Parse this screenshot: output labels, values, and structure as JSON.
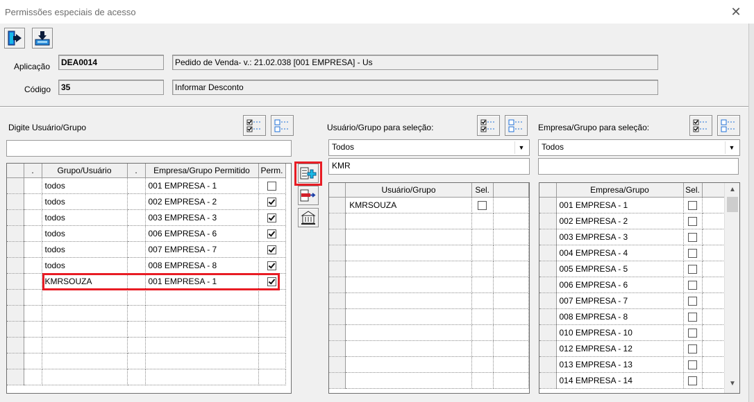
{
  "window": {
    "title": "Permissões especiais de acesso",
    "close_glyph": "✕"
  },
  "header": {
    "aplicacao_label": "Aplicação",
    "aplicacao_code": "DEA0014",
    "aplicacao_desc": "Pedido de Venda- v.: 21.02.038  [001 EMPRESA] - Us",
    "codigo_label": "Código",
    "codigo_code": "35",
    "codigo_desc": "Informar Desconto"
  },
  "left": {
    "label": "Digite Usuário/Grupo",
    "search_value": "",
    "columns": [
      ".",
      "Grupo/Usuário",
      ".",
      "Empresa/Grupo Permitido",
      "Perm."
    ],
    "rows": [
      {
        "user": "todos",
        "company": "001 EMPRESA - 1",
        "perm": false
      },
      {
        "user": "todos",
        "company": "002 EMPRESA - 2",
        "perm": true
      },
      {
        "user": "todos",
        "company": "003 EMPRESA - 3",
        "perm": true
      },
      {
        "user": "todos",
        "company": "006 EMPRESA - 6",
        "perm": true
      },
      {
        "user": "todos",
        "company": "007 EMPRESA - 7",
        "perm": true
      },
      {
        "user": "todos",
        "company": "008 EMPRESA - 8",
        "perm": true
      },
      {
        "user": "KMRSOUZA",
        "company": "001 EMPRESA - 1",
        "perm": true
      }
    ],
    "empty_rows": 6
  },
  "middle": {
    "label": "Usuário/Grupo para seleção:",
    "combo_value": "Todos",
    "filter_value": "KMR",
    "columns": [
      "Usuário/Grupo",
      "Sel."
    ],
    "rows": [
      {
        "user": "KMRSOUZA",
        "sel": false
      }
    ],
    "empty_rows": 11
  },
  "right": {
    "label": "Empresa/Grupo para seleção:",
    "combo_value": "Todos",
    "filter_value": "",
    "columns": [
      "Empresa/Grupo",
      "Sel."
    ],
    "rows": [
      {
        "company": "001 EMPRESA - 1",
        "sel": false
      },
      {
        "company": "002 EMPRESA - 2",
        "sel": false
      },
      {
        "company": "003 EMPRESA - 3",
        "sel": false
      },
      {
        "company": "004 EMPRESA - 4",
        "sel": false
      },
      {
        "company": "005 EMPRESA - 5",
        "sel": false
      },
      {
        "company": "006 EMPRESA - 6",
        "sel": false
      },
      {
        "company": "007 EMPRESA - 7",
        "sel": false
      },
      {
        "company": "008 EMPRESA - 8",
        "sel": false
      },
      {
        "company": "010 EMPRESA - 10",
        "sel": false
      },
      {
        "company": "012 EMPRESA - 12",
        "sel": false
      },
      {
        "company": "013 EMPRESA - 13",
        "sel": false
      },
      {
        "company": "014 EMPRESA - 14",
        "sel": false
      }
    ]
  },
  "icons": {
    "exit": "exit-door-icon",
    "save": "save-download-icon",
    "check_all": "check-all-icon",
    "uncheck_all": "uncheck-all-icon",
    "add": "add-permission-icon",
    "remove": "remove-permission-icon",
    "building": "building-icon"
  },
  "colors": {
    "highlight": "#e81c24",
    "form_bg": "#f0f0f0",
    "icon_blue": "#1e6fd9",
    "icon_cyan": "#19b9e6"
  }
}
